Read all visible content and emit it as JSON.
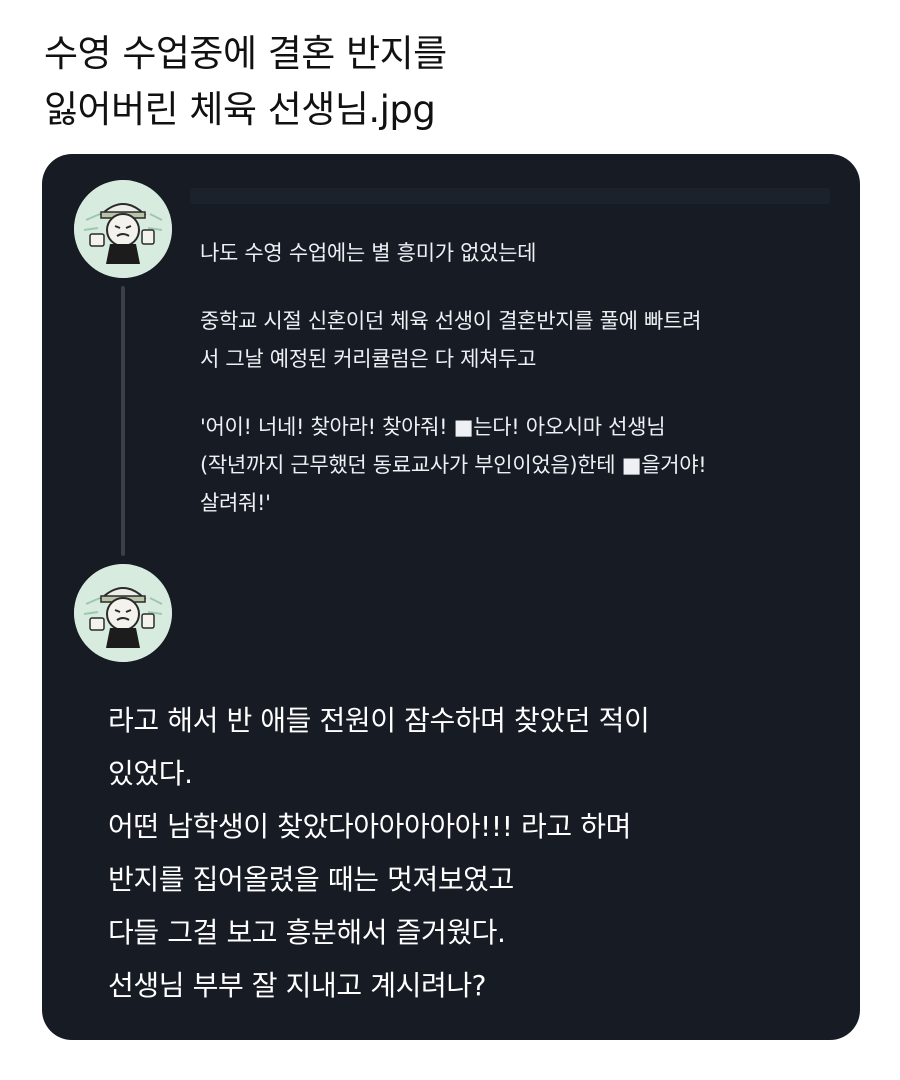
{
  "page": {
    "title_lines": [
      "수영 수업중에 결혼 반지를",
      "잃어버린 체육 선생님.jpg"
    ]
  },
  "thread": {
    "reply": {
      "avatar_icon": "cartoon-character-avatar-icon",
      "paragraphs": [
        "나도 수영 수업에는  별 흥미가 없었는데",
        "중학교 시절 신혼이던 체육 선생이 결혼반지를 풀에 빠트려\n서 그날 예정된 커리큘럼은 다 제쳐두고",
        "'어이! 너네! 찾아라! 찾아줘! ■는다! 아오시마 선생님\n(작년까지 근무했던 동료교사가 부인이었음)한테 ■을거야!\n살려줘!'"
      ]
    },
    "continuation": {
      "avatar_icon": "cartoon-character-avatar-icon",
      "text": "라고 해서 반 애들 전원이 잠수하며 찾았던 적이\n있었다.\n어떤 남학생이 찾았다아아아아아!!! 라고 하며\n반지를 집어올렸을 때는 멋져보였고\n다들 그걸 보고 흥분해서 즐거웠다.\n선생님 부부 잘 지내고 계시려나?"
    }
  },
  "colors": {
    "card_background": "#161b24",
    "thread_line": "#3a3f48",
    "avatar_background": "#d7ecdf",
    "text_primary": "#ffffff"
  }
}
